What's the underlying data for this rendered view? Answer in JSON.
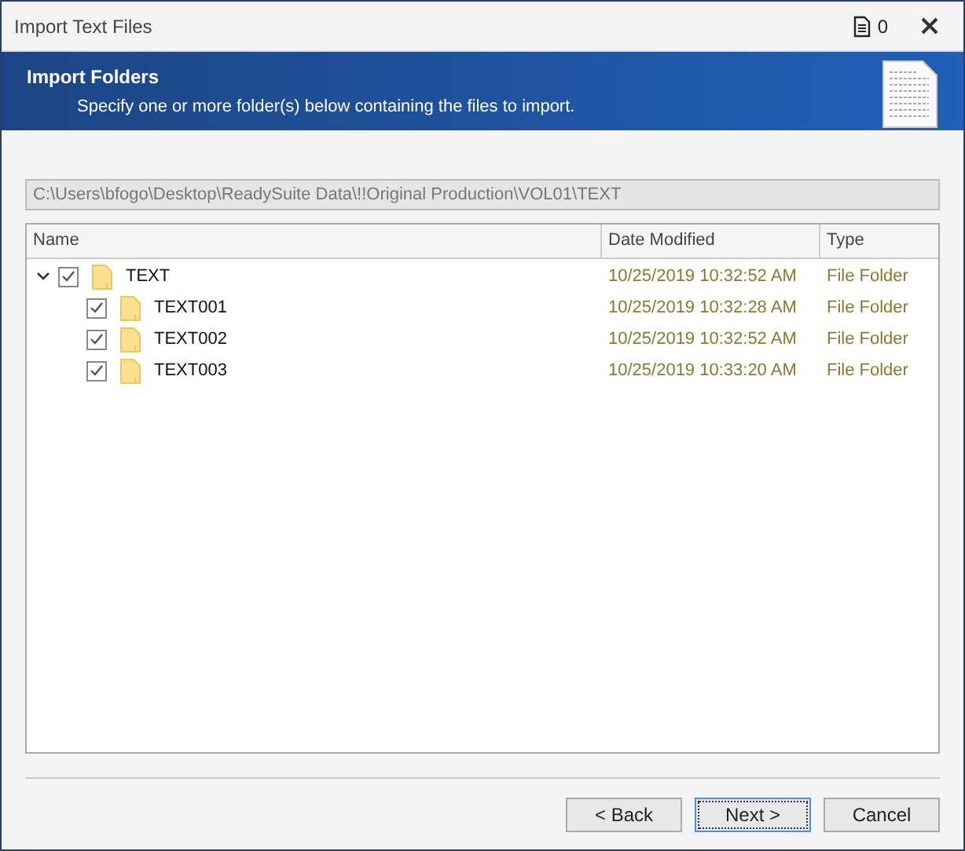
{
  "window": {
    "title": "Import Text Files",
    "file_count": "0"
  },
  "banner": {
    "title": "Import Folders",
    "subtitle": "Specify one or more folder(s) below containing the files to import."
  },
  "path_field": {
    "value": "C:\\Users\\bfogo\\Desktop\\ReadySuite Data\\!!Original Production\\VOL01\\TEXT"
  },
  "table": {
    "columns": [
      "Name",
      "Date Modified",
      "Type"
    ],
    "rows": [
      {
        "name": "TEXT",
        "date": "10/25/2019 10:32:52 AM",
        "type": "File Folder",
        "checked": true,
        "expanded": true,
        "children": [
          {
            "name": "TEXT001",
            "date": "10/25/2019 10:32:28 AM",
            "type": "File Folder",
            "checked": true
          },
          {
            "name": "TEXT002",
            "date": "10/25/2019 10:32:52 AM",
            "type": "File Folder",
            "checked": true
          },
          {
            "name": "TEXT003",
            "date": "10/25/2019 10:33:20 AM",
            "type": "File Folder",
            "checked": true
          }
        ]
      }
    ]
  },
  "buttons": [
    {
      "label": "< Back",
      "focused": false
    },
    {
      "label": "Next >",
      "focused": true
    },
    {
      "label": "Cancel",
      "focused": false
    }
  ]
}
